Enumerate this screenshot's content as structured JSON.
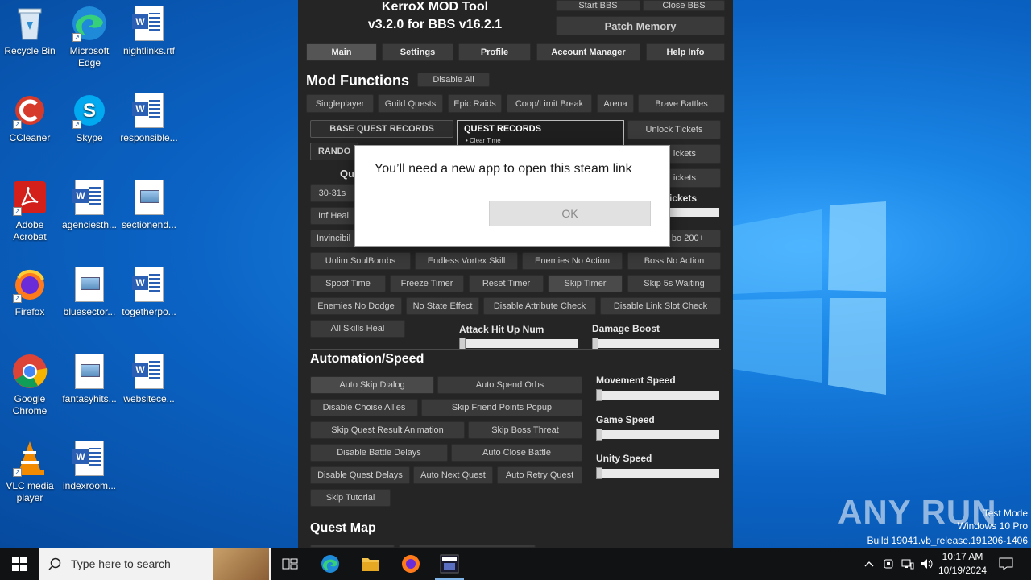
{
  "desktop": {
    "icons": [
      {
        "label": "Recycle Bin",
        "icon": "recycle-bin-icon"
      },
      {
        "label": "Microsoft Edge",
        "icon": "edge-icon"
      },
      {
        "label": "nightlinks.rtf",
        "icon": "word-doc-icon"
      },
      {
        "label": "CCleaner",
        "icon": "ccleaner-icon"
      },
      {
        "label": "Skype",
        "icon": "skype-icon"
      },
      {
        "label": "responsible...",
        "icon": "word-doc-icon"
      },
      {
        "label": "Adobe Acrobat",
        "icon": "acrobat-icon"
      },
      {
        "label": "agenciesth...",
        "icon": "word-doc-icon"
      },
      {
        "label": "sectionend...",
        "icon": "image-file-icon"
      },
      {
        "label": "Firefox",
        "icon": "firefox-icon"
      },
      {
        "label": "bluesector...",
        "icon": "image-file-icon"
      },
      {
        "label": "togetherpo...",
        "icon": "word-doc-icon"
      },
      {
        "label": "Google Chrome",
        "icon": "chrome-icon"
      },
      {
        "label": "fantasyhits...",
        "icon": "image-file-icon"
      },
      {
        "label": "websitece...",
        "icon": "word-doc-icon"
      },
      {
        "label": "VLC media player",
        "icon": "vlc-icon"
      },
      {
        "label": "indexroom...",
        "icon": "word-doc-icon"
      }
    ]
  },
  "tool": {
    "title_line1": "KerroX MOD Tool",
    "title_line2": "v3.2.0 for BBS v16.2.1",
    "top_buttons": {
      "start_bbs": "Start BBS",
      "close_bbs": "Close BBS",
      "patch_memory": "Patch Memory"
    },
    "tabs": [
      "Main",
      "Settings",
      "Profile",
      "Account Manager",
      "Help Info"
    ],
    "mod_functions": {
      "title": "Mod Functions",
      "disable_all": "Disable All",
      "mode_tabs": [
        "Singleplayer",
        "Guild Quests",
        "Epic Raids",
        "Coop/Limit Break",
        "Arena",
        "Brave Battles"
      ],
      "base_quest_records": "BASE QUEST RECORDS",
      "random_partial": "RANDO",
      "quest_records_title": "QUEST RECORDS",
      "quest_records_item": "• Clear Time",
      "ticket_buttons": [
        "Unlock Tickets",
        "ickets",
        "ickets"
      ],
      "tickets_label": "ickets",
      "qu_partial": "Qu",
      "row_a": [
        "30-31s"
      ],
      "inf_heal": "Inf Heal",
      "invincible": "Invincibil",
      "combo": "bo 200+",
      "row1": [
        "Unlim SoulBombs",
        "Endless Vortex Skill",
        "Enemies No Action",
        "Boss No Action"
      ],
      "row2": [
        "Spoof Time",
        "Freeze Timer",
        "Reset Timer",
        "Skip Timer",
        "Skip 5s Waiting"
      ],
      "row3": [
        "Enemies No Dodge",
        "No State Effect",
        "Disable Attribute Check",
        "Disable Link Slot Check"
      ],
      "all_skills_heal": "All Skills Heal",
      "attack_hit_up_num": "Attack Hit Up Num",
      "damage_boost": "Damage Boost"
    },
    "automation": {
      "title": "Automation/Speed",
      "buttons": [
        "Auto Skip Dialog",
        "Auto Spend Orbs",
        "Disable Choise Allies",
        "Skip Friend Points Popup",
        "Skip Quest Result Animation",
        "Skip Boss Threat",
        "Disable Battle Delays",
        "Auto Close Battle",
        "Disable Quest Delays",
        "Auto Next Quest",
        "Auto Retry Quest",
        "Skip Tutorial"
      ],
      "movement_speed": "Movement Speed",
      "game_speed": "Game Speed",
      "unity_speed": "Unity Speed"
    },
    "quest_map": {
      "title": "Quest Map"
    }
  },
  "dialog": {
    "message": "You’ll need a new app to open this steam link",
    "ok": "OK"
  },
  "watermark": {
    "text": "ANY RUN",
    "line1": "Test Mode",
    "line2": "Windows 10 Pro",
    "line3": "Build 19041.vb_release.191206-1406"
  },
  "taskbar": {
    "search_placeholder": "Type here to search",
    "time": "10:17 AM",
    "date": "10/19/2024"
  }
}
